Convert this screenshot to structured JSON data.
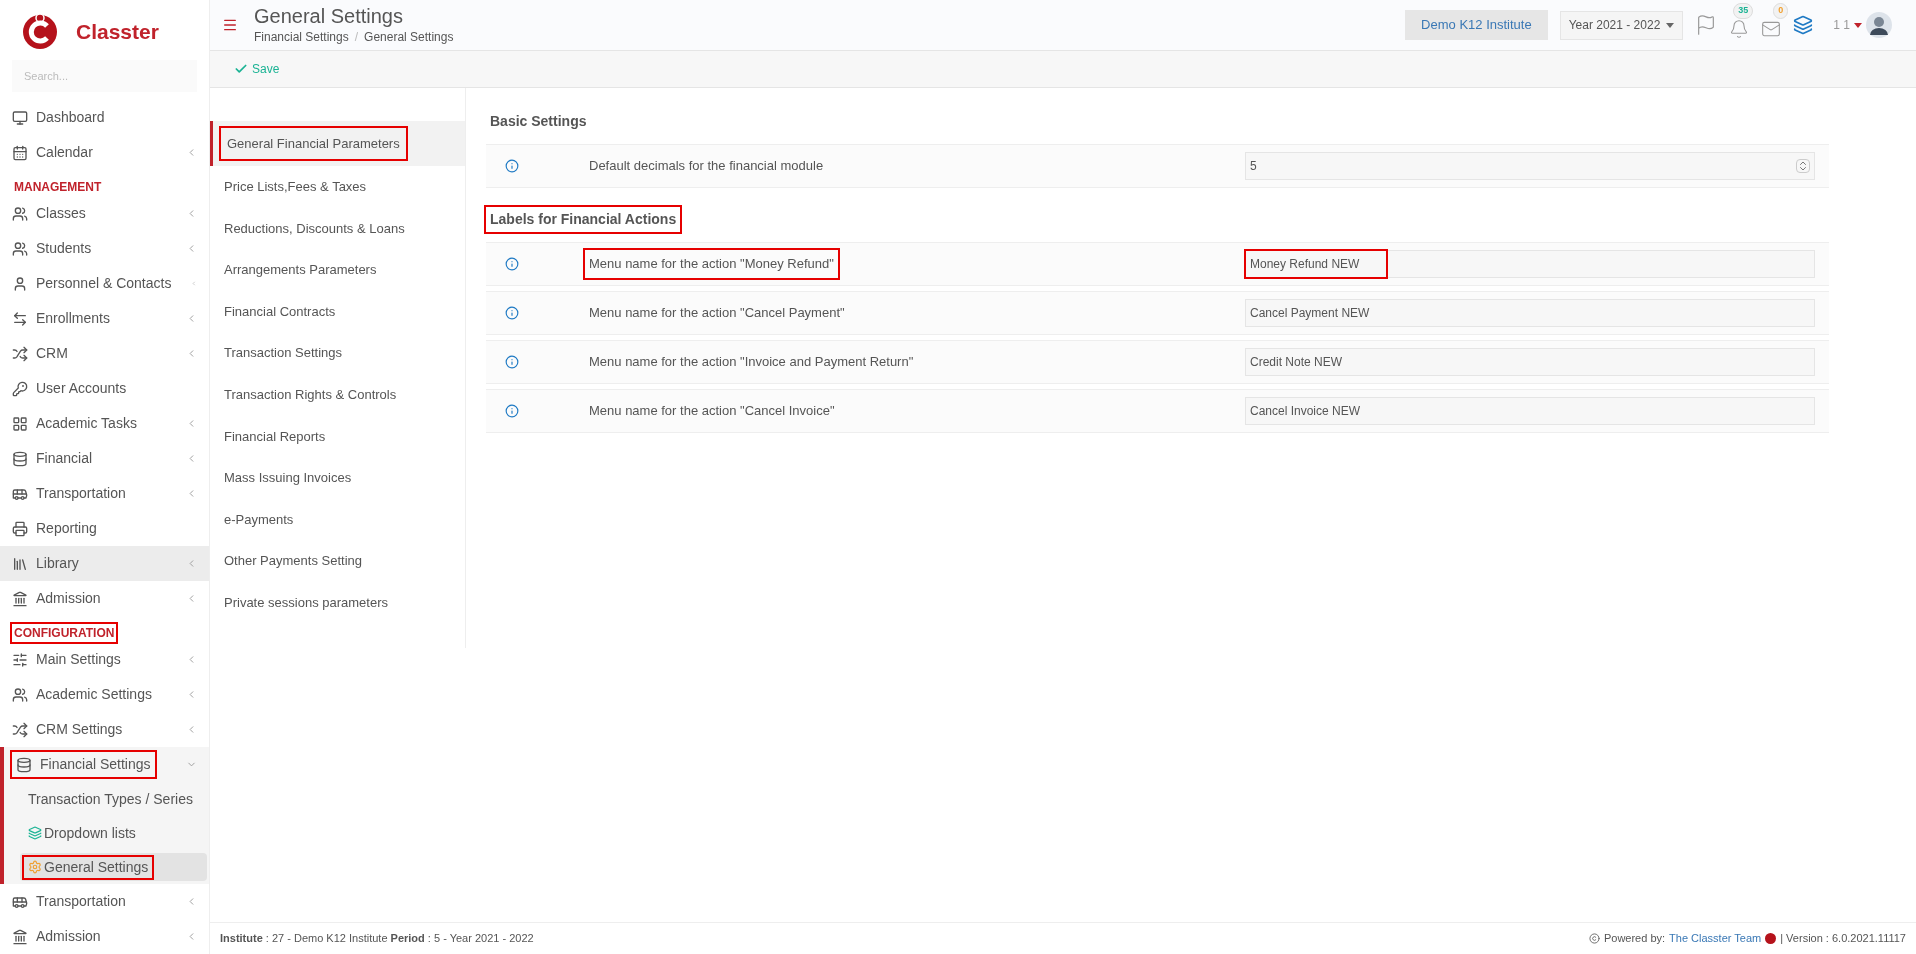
{
  "sidebar": {
    "logo_text": "Classter",
    "search": {
      "placeholder": "Search..."
    },
    "items": [
      {
        "kind": "item",
        "label": "Dashboard",
        "has_submenu": false,
        "shaded": false,
        "highlighted": false
      },
      {
        "kind": "item",
        "label": "Calendar",
        "has_submenu": true,
        "shaded": false,
        "highlighted": false
      },
      {
        "kind": "section",
        "label": "MANAGEMENT",
        "highlighted": false
      },
      {
        "kind": "item",
        "label": "Classes",
        "has_submenu": true,
        "shaded": false,
        "highlighted": false
      },
      {
        "kind": "item",
        "label": "Students",
        "has_submenu": true,
        "shaded": false,
        "highlighted": false
      },
      {
        "kind": "item",
        "label": "Personnel & Contacts",
        "has_submenu": true,
        "shaded": false,
        "highlighted": false
      },
      {
        "kind": "item",
        "label": "Enrollments",
        "has_submenu": true,
        "shaded": false,
        "highlighted": false
      },
      {
        "kind": "item",
        "label": "CRM",
        "has_submenu": true,
        "shaded": false,
        "highlighted": false
      },
      {
        "kind": "item",
        "label": "User Accounts",
        "has_submenu": false,
        "shaded": false,
        "highlighted": false
      },
      {
        "kind": "item",
        "label": "Academic Tasks",
        "has_submenu": true,
        "shaded": false,
        "highlighted": false
      },
      {
        "kind": "item",
        "label": "Financial",
        "has_submenu": true,
        "shaded": false,
        "highlighted": false
      },
      {
        "kind": "item",
        "label": "Transportation",
        "has_submenu": true,
        "shaded": false,
        "highlighted": false
      },
      {
        "kind": "item",
        "label": "Reporting",
        "has_submenu": false,
        "shaded": false,
        "highlighted": false
      },
      {
        "kind": "item",
        "label": "Library",
        "has_submenu": true,
        "shaded": true,
        "highlighted": false
      },
      {
        "kind": "item",
        "label": "Admission",
        "has_submenu": true,
        "shaded": false,
        "highlighted": false
      },
      {
        "kind": "section",
        "label": "CONFIGURATION",
        "highlighted": true
      },
      {
        "kind": "item",
        "label": "Main Settings",
        "has_submenu": true,
        "shaded": false,
        "highlighted": false
      },
      {
        "kind": "item",
        "label": "Academic Settings",
        "has_submenu": true,
        "shaded": false,
        "highlighted": false
      },
      {
        "kind": "item",
        "label": "CRM Settings",
        "has_submenu": true,
        "shaded": false,
        "highlighted": false
      },
      {
        "kind": "item",
        "label": "Financial Settings",
        "has_submenu": true,
        "shaded": false,
        "highlighted": true,
        "expanded": true,
        "children": [
          {
            "label": "Transaction Types / Series",
            "selected": false,
            "highlighted": false
          },
          {
            "label": "Dropdown lists",
            "selected": false,
            "highlighted": false
          },
          {
            "label": "General Settings",
            "selected": true,
            "highlighted": true
          }
        ]
      },
      {
        "kind": "item",
        "label": "Transportation",
        "has_submenu": true,
        "shaded": false,
        "highlighted": false
      },
      {
        "kind": "item",
        "label": "Admission",
        "has_submenu": true,
        "shaded": false,
        "highlighted": false
      }
    ]
  },
  "header": {
    "title": "General Settings",
    "breadcrumb": [
      "Financial Settings",
      "General Settings"
    ],
    "breadcrumb_separator": "/",
    "institute": "Demo K12 Institute",
    "year": "Year 2021 - 2022",
    "notifications": "35",
    "messages": "0",
    "user": "1 1"
  },
  "toolbar": {
    "save": "Save"
  },
  "settings_menu": [
    {
      "label": "General Financial Parameters",
      "selected": true,
      "highlighted": true
    },
    {
      "label": "Price Lists,Fees & Taxes",
      "selected": false,
      "highlighted": false
    },
    {
      "label": "Reductions, Discounts & Loans",
      "selected": false,
      "highlighted": false
    },
    {
      "label": "Arrangements Parameters",
      "selected": false,
      "highlighted": false
    },
    {
      "label": "Financial Contracts",
      "selected": false,
      "highlighted": false
    },
    {
      "label": "Transaction Settings",
      "selected": false,
      "highlighted": false
    },
    {
      "label": "Transaction Rights & Controls",
      "selected": false,
      "highlighted": false
    },
    {
      "label": "Financial Reports",
      "selected": false,
      "highlighted": false
    },
    {
      "label": "Mass Issuing Invoices",
      "selected": false,
      "highlighted": false
    },
    {
      "label": "e-Payments",
      "selected": false,
      "highlighted": false
    },
    {
      "label": "Other Payments Setting",
      "selected": false,
      "highlighted": false
    },
    {
      "label": "Private sessions parameters",
      "selected": false,
      "highlighted": false
    }
  ],
  "sections": [
    {
      "title": "Basic Settings",
      "highlighted": false,
      "rows": [
        {
          "kind": "number",
          "label": "Default decimals for the financial module",
          "value": "5",
          "label_highlighted": false,
          "value_highlighted": false
        }
      ]
    },
    {
      "title": "Labels for Financial Actions",
      "highlighted": true,
      "rows": [
        {
          "kind": "text",
          "label": "Menu name for the action \"Money Refund\"",
          "value": "Money Refund NEW",
          "label_highlighted": true,
          "value_highlighted": true
        },
        {
          "kind": "text",
          "label": "Menu name for the action \"Cancel Payment\"",
          "value": "Cancel Payment NEW",
          "label_highlighted": false,
          "value_highlighted": false
        },
        {
          "kind": "text",
          "label": "Menu name for the action \"Invoice and Payment Return\"",
          "value": "Credit Note NEW",
          "label_highlighted": false,
          "value_highlighted": false
        },
        {
          "kind": "text",
          "label": "Menu name for the action \"Cancel Invoice\"",
          "value": "Cancel Invoice NEW",
          "label_highlighted": false,
          "value_highlighted": false
        }
      ]
    }
  ],
  "footer": {
    "info": "**Institute** : 27 - Demo K12 Institute **Period** : 5 - Year 2021 - 2022",
    "powered": "Powered by:",
    "team": "The Classter Team",
    "version": "| Version : 6.0.2021.11117"
  }
}
